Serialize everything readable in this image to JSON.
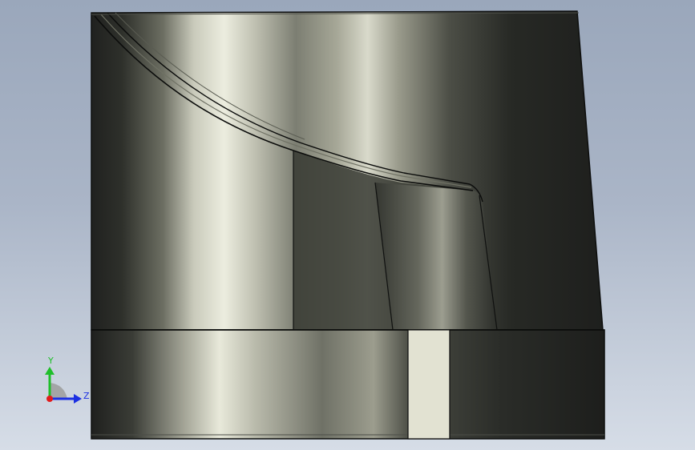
{
  "viewport": {
    "background_top": "#9aa7bb",
    "background_bottom": "#d6dde7"
  },
  "model": {
    "part_color": "#2b2d29",
    "highlight_color": "#e9eadc",
    "slot_color": "#e2e2d2"
  },
  "triad": {
    "x_axis_color": "#e21b1b",
    "y_axis_color": "#1fbf2a",
    "z_axis_color": "#1b2fe2",
    "y_label": "Y",
    "z_label": "Z"
  }
}
